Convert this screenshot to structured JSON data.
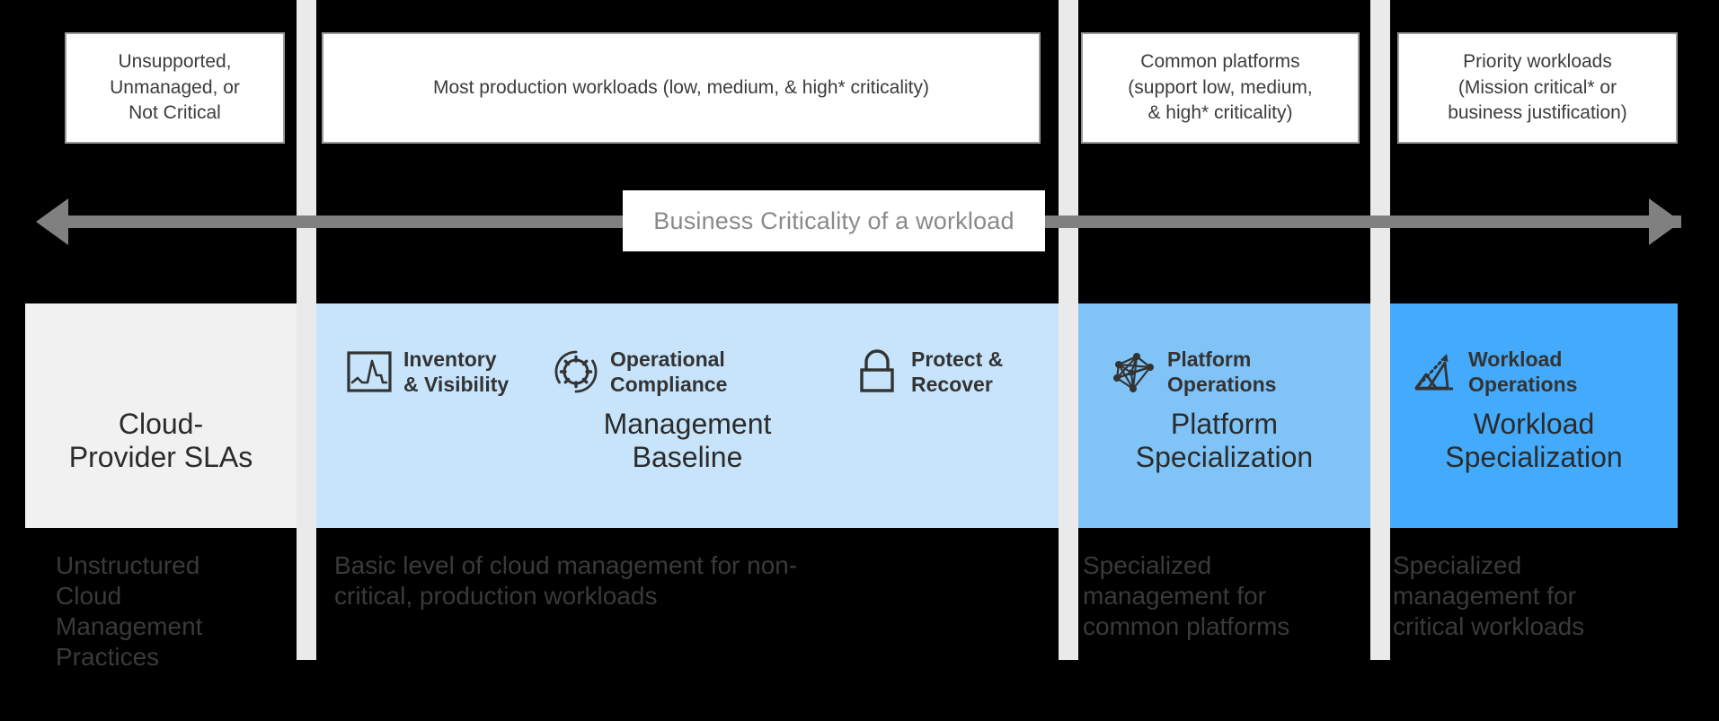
{
  "diagram": {
    "title": "Cloud management scope by business criticality",
    "colors": {
      "background": "#000000",
      "divider": "#EAEAEA",
      "arrow": "#808080",
      "band_sla": "#F1F1F1",
      "band_baseline": "#C7E4FB",
      "band_platform": "#7FC3F7",
      "band_workload": "#44AAFB",
      "box_fill": "#FFFFFF",
      "box_border": "#9A9A9A",
      "caption_text": "#3C3C3C",
      "band_title_text": "#2B2B2B",
      "desc_text": "#3A3A3A",
      "arrow_label_text": "#8A8A8A"
    },
    "axis": {
      "label": "Business Criticality of a workload",
      "left_arrow": "left-arrow-head",
      "right_arrow": "right-arrow-head"
    },
    "criticality_boxes": [
      {
        "text": "Unsupported,\nUnmanaged, or\nNot Critical"
      },
      {
        "text": "Most production workloads (low, medium, & high* criticality)"
      },
      {
        "text": "Common platforms\n(support low, medium,\n& high* criticality)"
      },
      {
        "text": "Priority workloads\n(Mission critical* or\nbusiness justification)"
      }
    ],
    "columns": [
      {
        "key": "cloud-provider-slas",
        "band_title": "Cloud-\nProvider SLAs",
        "description": "Unstructured\nCloud\nManagement\nPractices",
        "capabilities": []
      },
      {
        "key": "management-baseline",
        "band_title": "Management\nBaseline",
        "description": "Basic level of cloud management for non-\ncritical, production workloads",
        "capabilities": [
          {
            "icon": "line-chart-icon",
            "label": "Inventory\n& Visibility"
          },
          {
            "icon": "gear-in-circle-icon",
            "label": "Operational\nCompliance"
          },
          {
            "icon": "padlock-icon",
            "label": "Protect &\nRecover"
          }
        ]
      },
      {
        "key": "platform-specialization",
        "band_title": "Platform\nSpecialization",
        "description": "Specialized\nmanagement for\ncommon platforms",
        "capabilities": [
          {
            "icon": "network-nodes-icon",
            "label": "Platform\nOperations"
          }
        ]
      },
      {
        "key": "workload-specialization",
        "band_title": "Workload\nSpecialization",
        "description": "Specialized\nmanagement for\ncritical workloads",
        "capabilities": [
          {
            "icon": "mountain-growth-icon",
            "label": "Workload\nOperations"
          }
        ]
      }
    ]
  }
}
